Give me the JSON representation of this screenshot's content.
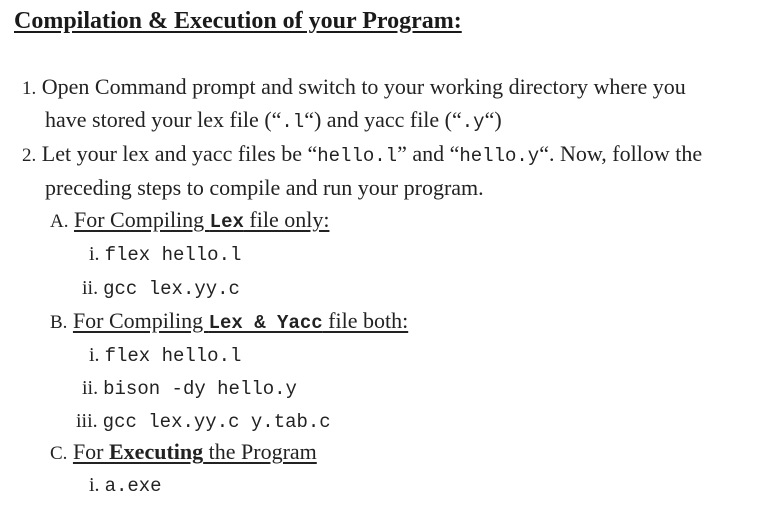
{
  "title": "Compilation & Execution of your Program:",
  "steps": [
    {
      "marker": "1.",
      "line1_text": "Open Command prompt and switch to your working directory where you",
      "line2_pre": "have stored your lex file (“",
      "line2_code1": ".l",
      "line2_mid": "“) and yacc file (“",
      "line2_code2": ".y",
      "line2_post": "“)"
    },
    {
      "marker": "2.",
      "line1_pre": "Let your lex and yacc files be “",
      "line1_code1": "hello.l",
      "line1_mid": "” and “",
      "line1_code2": "hello.y",
      "line1_post": "“. Now, follow the",
      "line2_text": "preceding steps to compile and run your program."
    }
  ],
  "sections": [
    {
      "marker": "A.",
      "heading_pre": "For Compiling ",
      "heading_code": "Lex",
      "heading_post": " file only:",
      "items": [
        {
          "marker": "i.",
          "cmd": "flex hello.l"
        },
        {
          "marker": "ii.",
          "cmd": "gcc lex.yy.c"
        }
      ]
    },
    {
      "marker": "B.",
      "heading_pre": "For Compiling ",
      "heading_code": "Lex & Yacc",
      "heading_post": " file both:",
      "items": [
        {
          "marker": "i.",
          "cmd": "flex hello.l"
        },
        {
          "marker": "ii.",
          "cmd": "bison -dy hello.y"
        },
        {
          "marker": "iii.",
          "cmd": "gcc lex.yy.c y.tab.c"
        }
      ]
    },
    {
      "marker": "C.",
      "heading_pre": "For ",
      "heading_bold": "Executing",
      "heading_post": " the Program",
      "items": [
        {
          "marker": "i.",
          "cmd": "a.exe"
        }
      ]
    }
  ]
}
